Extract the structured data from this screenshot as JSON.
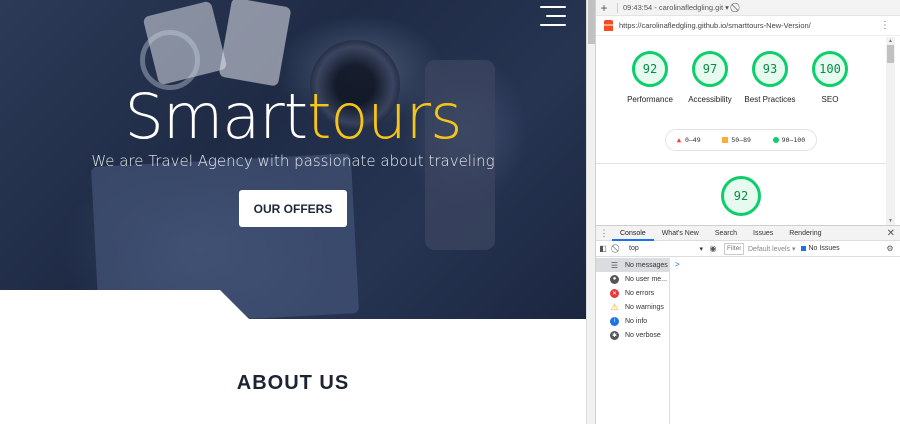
{
  "site": {
    "brand_main": "Smart",
    "brand_accent": "tours",
    "tagline": "We are Travel Agency with passionate about traveling",
    "cta_label": "OUR OFFERS",
    "about_title": "ABOUT US",
    "colors": {
      "accent": "#f5c518",
      "hero_overlay": "#2c3a58"
    }
  },
  "devtools": {
    "toolbar": {
      "report_selector": "09:43:54 - carolinafledgling.git",
      "dropdown_glyph": "▾"
    },
    "url": "https://carolinafledgling.github.io/smarttours-New-Version/",
    "scores": [
      {
        "value": "92",
        "label": "Performance"
      },
      {
        "value": "97",
        "label": "Accessibility"
      },
      {
        "value": "93",
        "label": "Best Practices"
      },
      {
        "value": "100",
        "label": "SEO"
      }
    ],
    "legend": {
      "fail": "0–49",
      "average": "50–89",
      "pass": "90–100"
    },
    "detail_score": "92",
    "drawer_tabs": [
      "Console",
      "What's New",
      "Search",
      "Issues",
      "Rendering"
    ],
    "console_toolbar": {
      "context": "top",
      "filter_placeholder": "Filter",
      "levels": "Default levels ▾",
      "issues": "No Issues"
    },
    "console_sidebar": [
      {
        "icon": "list-icon",
        "label": "No messages"
      },
      {
        "icon": "user-icon",
        "label": "No user me..."
      },
      {
        "icon": "error-icon",
        "label": "No errors"
      },
      {
        "icon": "warning-icon",
        "label": "No warnings"
      },
      {
        "icon": "info-icon",
        "label": "No info"
      },
      {
        "icon": "verbose-icon",
        "label": "No verbose"
      }
    ],
    "prompt": ">",
    "colors": {
      "pass": "#0cce6b",
      "average": "#ffaa33",
      "fail": "#ff3333",
      "active_tab": "#1a73e8"
    }
  }
}
